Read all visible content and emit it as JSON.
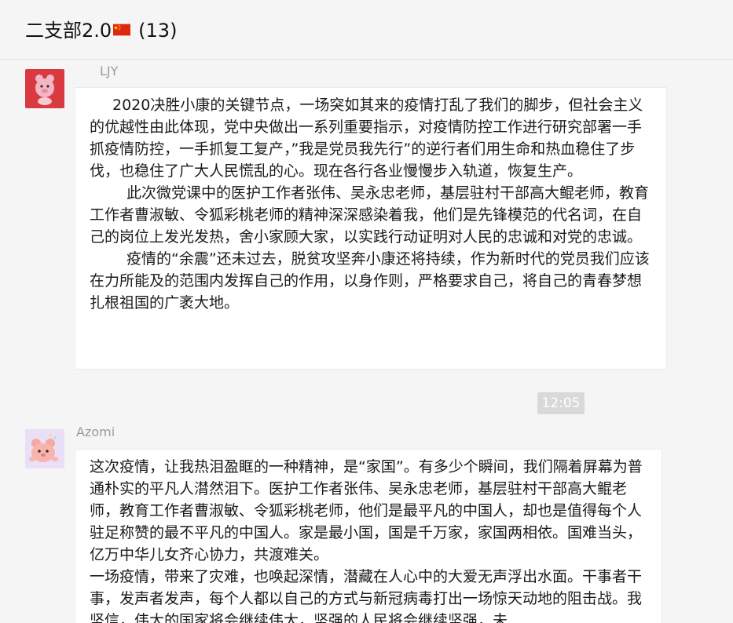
{
  "header": {
    "title": "二支部2.0",
    "member_count": "(13)"
  },
  "messages": [
    {
      "sender": "LJY",
      "paragraphs": [
        "2020决胜小康的关键节点，一场突如其来的疫情打乱了我们的脚步，但社会主义的优越性由此体现，党中央做出一系列重要指示，对疫情防控工作进行研究部署一手抓疫情防控，一手抓复工复产，”我是党员我先行”的逆行者们用生命和热血稳住了步伐，也稳住了广大人民慌乱的心。现在各行各业慢慢步入轨道，恢复生产。",
        "此次微党课中的医护工作者张伟、吴永忠老师，基层驻村干部高大鲲老师，教育工作者曹淑敏、令狐彩桃老师的精神深深感染着我，他们是先锋模范的代名词，在自己的岗位上发光发热，舍小家顾大家，以实践行动证明对人民的忠诚和对党的忠诚。",
        "疫情的“余震”还未过去，脱贫攻坚奔小康还将持续，作为新时代的党员我们应该在力所能及的范围内发挥自己的作用，以身作则，严格要求自己，将自己的青春梦想扎根祖国的广袤大地。"
      ]
    },
    {
      "sender": "Azomi",
      "paragraphs": [
        "这次疫情，让我热泪盈眶的一种精神，是“家国”。有多少个瞬间，我们隔着屏幕为普通朴实的平凡人潸然泪下。医护工作者张伟、吴永忠老师，基层驻村干部高大鲲老师，教育工作者曹淑敏、令狐彩桃老师，他们是最平凡的中国人，却也是值得每个人驻足称赞的最不平凡的中国人。家是最小国，国是千万家，家国两相依。国难当头，亿万中华儿女齐心协力，共渡难关。",
        "一场疫情，带来了灾难，也唤起深情，潜藏在人心中的大爱无声浮出水面。干事者干事，发声者发声，每个人都以自己的方式与新冠病毒打出一场惊天动地的阻击战。我坚信，伟大的国家将会继续伟大，坚强的人民将会继续坚强，未"
      ]
    }
  ],
  "timestamp": "12:05",
  "colors": {
    "background": "#f5f5f5",
    "bubble": "#ffffff",
    "flag_red": "#de2910",
    "flag_yellow": "#ffde00",
    "timestamp_bg": "#d9d9d9"
  },
  "icons": [
    "china-flag-icon",
    "avatar-ljy",
    "avatar-azomi"
  ]
}
